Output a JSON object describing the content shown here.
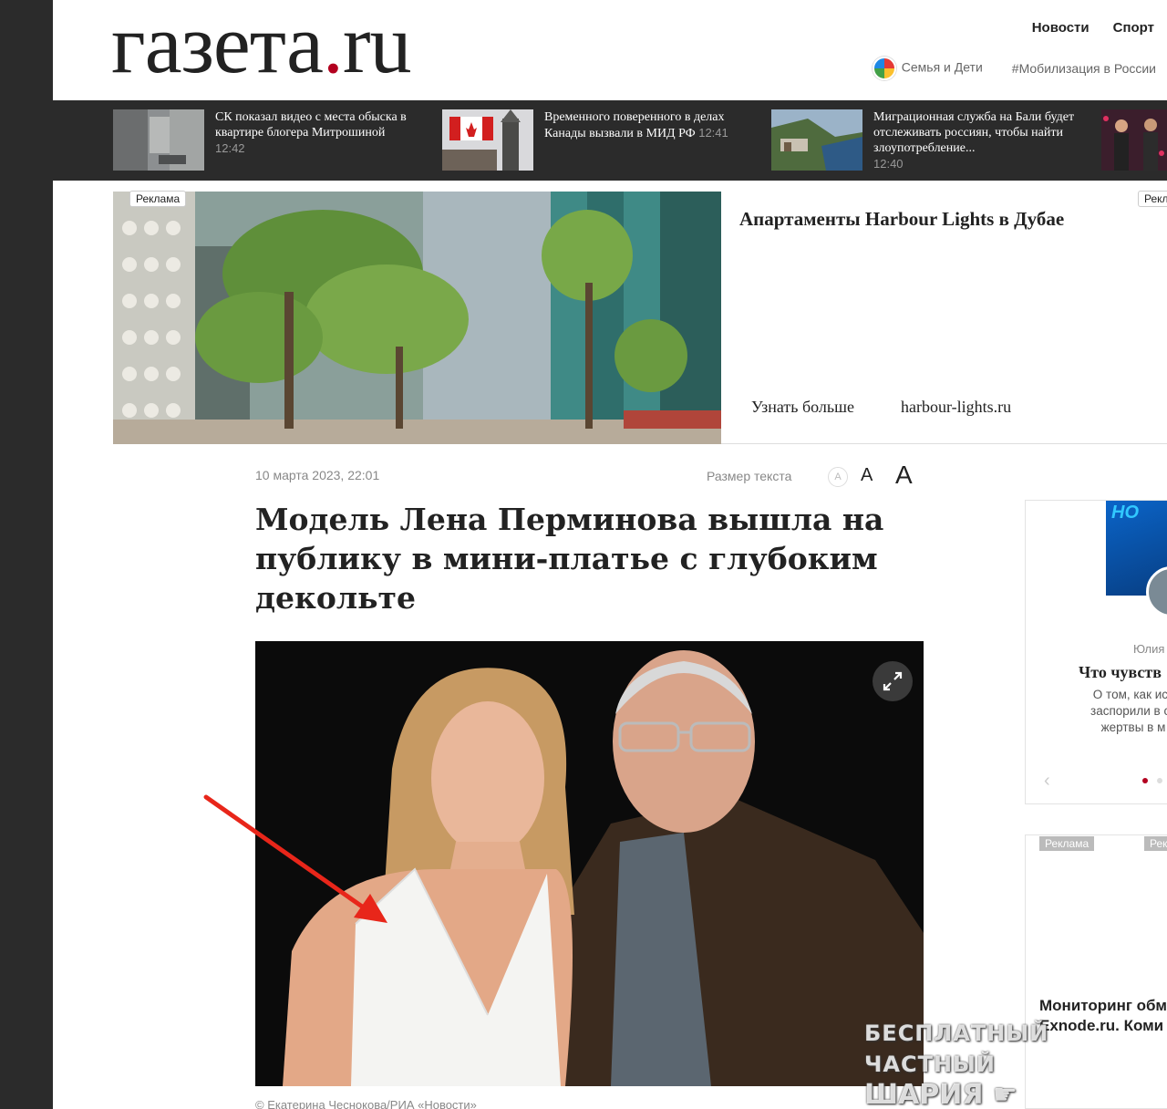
{
  "header": {
    "logo_main": "газета",
    "logo_dot": ".",
    "logo_tld": "ru",
    "nav_top": [
      "Новости",
      "Спорт"
    ],
    "nav_sub": {
      "family": "Семья и Дети",
      "tag": "#Мобилизация в России"
    }
  },
  "news_strip": [
    {
      "title": "СК показал видео с места обыска в квартире блогера Митрошиной",
      "time": "12:42"
    },
    {
      "title": "Временного поверенного в делах Канады вызвали в МИД РФ",
      "time": "12:41"
    },
    {
      "title": "Миграционная служба на Бали будет отслеживать россиян, чтобы найти злоупотребление...",
      "time": "12:40"
    }
  ],
  "ad_banner": {
    "tag_left": "Реклама",
    "tag_right": "Рекл",
    "title": "Апартаменты Harbour Lights в Дубае",
    "learn_more": "Узнать больше",
    "domain": "harbour-lights.ru"
  },
  "article": {
    "date": "10 марта 2023, 22:01",
    "text_size_label": "Размер текста",
    "size_small": "A",
    "size_mid": "A",
    "size_big": "A",
    "headline": "Модель Лена Перминова вышла на публику в мини-платье с глубоким декольте",
    "caption": "© Екатерина Чеснокова/РИА «Новости»"
  },
  "sidebar": {
    "card": {
      "thumb_text": "НО",
      "author": "Юлия",
      "title": "Что чувств",
      "text": "О том, как ист заспорили в су жертвы в м"
    },
    "ad": {
      "tag_left": "Реклама",
      "tag_right": "Рек",
      "title_line1": "Мониторинг обм",
      "title_line2": "Exnode.ru. Коми"
    }
  },
  "watermark": {
    "line1": "БЕСПЛАТНЫЙ ЧАСТНЫЙ",
    "line2": "ШАРИЯ ☛ Sharij.net"
  },
  "colors": {
    "accent": "#b3001f",
    "dark_bar": "#2b2b2b",
    "arrow": "#e8261a"
  }
}
